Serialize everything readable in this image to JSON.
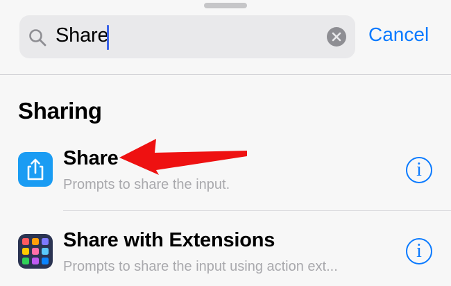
{
  "search": {
    "value": "Share",
    "cancel_label": "Cancel"
  },
  "section": {
    "title": "Sharing"
  },
  "actions": [
    {
      "title": "Share",
      "subtitle": "Prompts to share the input.",
      "icon": "share-icon",
      "icon_color": "#1a9cf3"
    },
    {
      "title": "Share with Extensions",
      "subtitle": "Prompts to share the input using action ext...",
      "icon": "extensions-grid-icon",
      "icon_color": "#2b3452"
    }
  ],
  "colors": {
    "accent": "#0a7aff",
    "annotation_arrow": "#ee1111"
  },
  "info_glyph": "i"
}
